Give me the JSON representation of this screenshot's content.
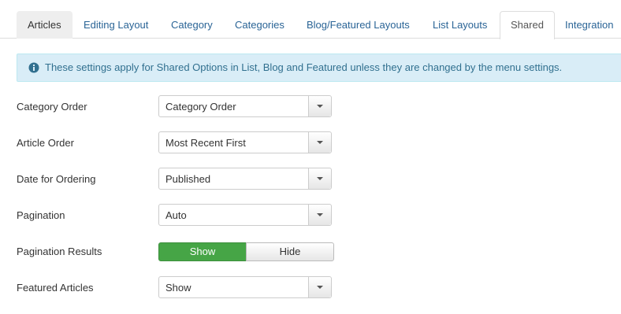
{
  "tabs": [
    {
      "label": "Articles"
    },
    {
      "label": "Editing Layout"
    },
    {
      "label": "Category"
    },
    {
      "label": "Categories"
    },
    {
      "label": "Blog/Featured Layouts"
    },
    {
      "label": "List Layouts"
    },
    {
      "label": "Shared"
    },
    {
      "label": "Integration"
    }
  ],
  "active_tab": "Shared",
  "alert": {
    "icon": "info-icon",
    "text": "These settings apply for Shared Options in List, Blog and Featured unless they are changed by the menu settings."
  },
  "fields": {
    "category_order": {
      "label": "Category Order",
      "value": "Category Order"
    },
    "article_order": {
      "label": "Article Order",
      "value": "Most Recent First"
    },
    "date_for_ordering": {
      "label": "Date for Ordering",
      "value": "Published"
    },
    "pagination": {
      "label": "Pagination",
      "value": "Auto"
    },
    "pagination_results": {
      "label": "Pagination Results",
      "options": [
        "Show",
        "Hide"
      ],
      "selected": "Show"
    },
    "featured_articles": {
      "label": "Featured Articles",
      "value": "Show"
    }
  },
  "colors": {
    "link": "#2a6496",
    "alert_bg": "#d9edf7",
    "alert_text": "#31708f",
    "toggle_on": "#46a546"
  }
}
